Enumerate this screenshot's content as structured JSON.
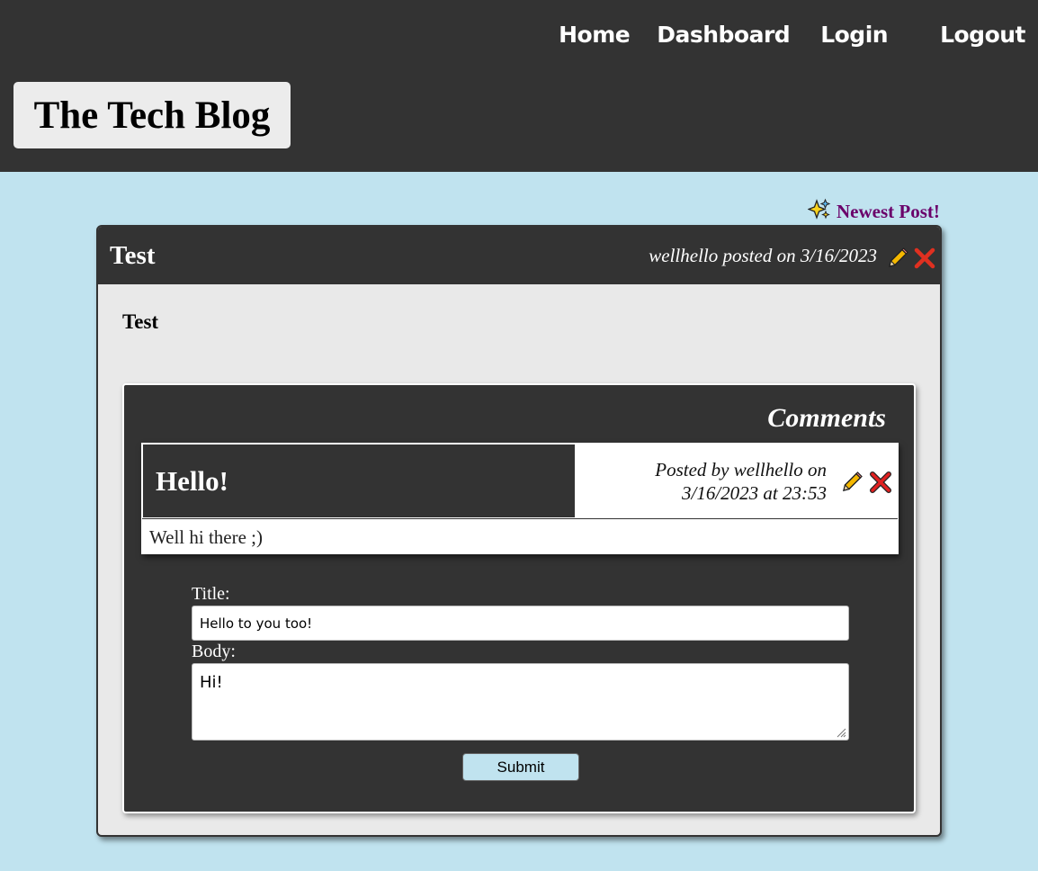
{
  "nav": {
    "home": "Home",
    "dashboard": "Dashboard",
    "login": "Login",
    "logout": "Logout"
  },
  "brand": {
    "title": "The Tech Blog"
  },
  "newest_post": {
    "label": "Newest Post!",
    "icon": "sparkles-icon"
  },
  "post": {
    "title": "Test",
    "meta": "wellhello posted on 3/16/2023",
    "body": "Test",
    "actions": {
      "edit_icon": "pencil-icon",
      "delete_icon": "cross-mark-icon"
    }
  },
  "comments": {
    "heading": "Comments",
    "items": [
      {
        "title": "Hello!",
        "meta_line1": "Posted by wellhello on",
        "meta_line2": "3/16/2023 at 23:53",
        "body": "Well hi there ;)"
      }
    ]
  },
  "comment_form": {
    "title_label": "Title:",
    "title_value": "Hello to you too!",
    "body_label": "Body:",
    "body_value": "Hi!",
    "submit_label": "Submit"
  },
  "colors": {
    "page_bg": "#c0e3ef",
    "dark": "#333333",
    "accent_purple": "#6a006a",
    "pencil_yellow": "#f5b800",
    "delete_red": "#e02020"
  }
}
